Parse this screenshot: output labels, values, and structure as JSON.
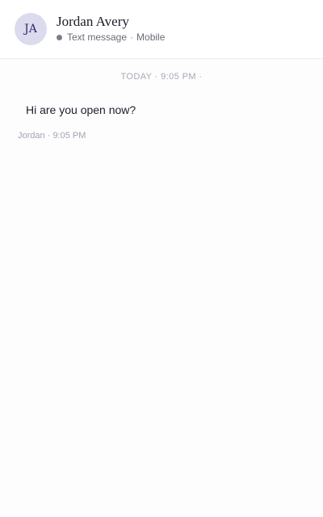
{
  "header": {
    "avatar_initials": "JA",
    "contact_name": "Jordan Avery",
    "channel": "Text message",
    "separator": "·",
    "device": "Mobile"
  },
  "conversation": {
    "day_divider": "TODAY · 9:05 PM ·",
    "messages": [
      {
        "text": "Hi are you open now?",
        "sender": "Jordan",
        "meta_separator": "·",
        "time": "9:05 PM"
      }
    ]
  },
  "colors": {
    "avatar_bg": "#dcdbee",
    "avatar_text": "#2f2d6b",
    "status_dot": "#7d7c8e",
    "muted_text": "#a8a8b8"
  }
}
